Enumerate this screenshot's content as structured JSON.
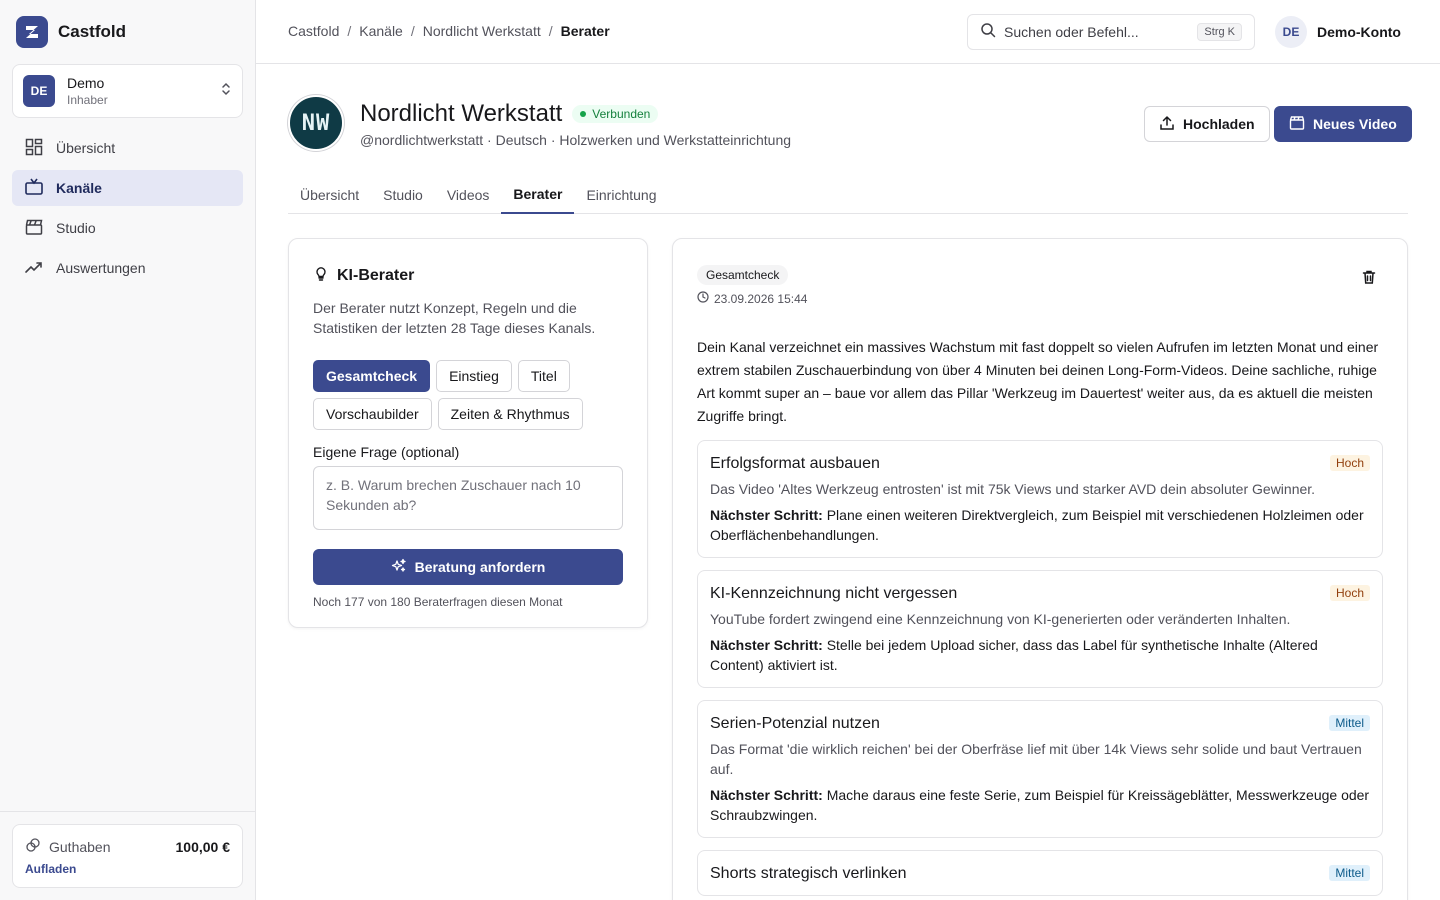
{
  "brand": {
    "name": "Castfold"
  },
  "account": {
    "initials": "DE",
    "name": "Demo",
    "role": "Inhaber"
  },
  "nav": [
    {
      "label": "Übersicht",
      "icon": "grid-icon"
    },
    {
      "label": "Kanäle",
      "icon": "tv-icon"
    },
    {
      "label": "Studio",
      "icon": "clapperboard-icon"
    },
    {
      "label": "Auswertungen",
      "icon": "trend-icon"
    }
  ],
  "balance": {
    "label": "Guthaben",
    "value": "100,00 €",
    "link": "Aufladen"
  },
  "breadcrumb": [
    "Castfold",
    "Kanäle",
    "Nordlicht Werkstatt",
    "Berater"
  ],
  "search": {
    "placeholder": "Suchen oder Befehl...",
    "shortcut": "Strg K"
  },
  "user": {
    "initials": "DE",
    "name": "Demo-Konto"
  },
  "channel": {
    "avatar_text": "NW",
    "name": "Nordlicht Werkstatt",
    "status": "Verbunden",
    "meta": "@nordlichtwerkstatt · Deutsch · Holzwerken und Werkstatteinrichtung",
    "upload_label": "Hochladen",
    "new_video_label": "Neues Video",
    "accent": "#3b4a8f"
  },
  "tabs": [
    "Übersicht",
    "Studio",
    "Videos",
    "Berater",
    "Einrichtung"
  ],
  "advisor": {
    "title": "KI-Berater",
    "description": "Der Berater nutzt Konzept, Regeln und die Statistiken der letzten 28 Tage dieses Kanals.",
    "chips": [
      "Gesamtcheck",
      "Einstieg",
      "Titel",
      "Vorschaubilder",
      "Zeiten & Rhythmus"
    ],
    "question_label": "Eigene Frage (optional)",
    "question_placeholder": "z. B. Warum brechen Zuschauer nach 10 Sekunden ab?",
    "submit_label": "Beratung anfordern",
    "quota": "Noch 177 von 180 Beraterfragen diesen Monat"
  },
  "result": {
    "tag": "Gesamtcheck",
    "date": "23.09.2026 15:44",
    "summary": "Dein Kanal verzeichnet ein massives Wachstum mit fast doppelt so vielen Aufrufen im letzten Monat und einer extrem stabilen Zuschauerbindung von über 4 Minuten bei deinen Long-Form-Videos. Deine sachliche, ruhige Art kommt super an – baue vor allem das Pillar 'Werkzeug im Dauertest' weiter aus, da es aktuell die meisten Zugriffe bringt.",
    "next_label": "Nächster Schritt:",
    "recommendations": [
      {
        "title": "Erfolgsformat ausbauen",
        "priority": "Hoch",
        "description": "Das Video 'Altes Werkzeug entrosten' ist mit 75k Views und starker AVD dein absoluter Gewinner.",
        "next": "Plane einen weiteren Direktvergleich, zum Beispiel mit verschiedenen Holzleimen oder Oberflächenbehandlungen."
      },
      {
        "title": "KI-Kennzeichnung nicht vergessen",
        "priority": "Hoch",
        "description": "YouTube fordert zwingend eine Kennzeichnung von KI-generierten oder veränderten Inhalten.",
        "next": "Stelle bei jedem Upload sicher, dass das Label für synthetische Inhalte (Altered Content) aktiviert ist."
      },
      {
        "title": "Serien-Potenzial nutzen",
        "priority": "Mittel",
        "description": "Das Format 'die wirklich reichen' bei der Oberfräse lief mit über 14k Views sehr solide und baut Vertrauen auf.",
        "next": "Mache daraus eine feste Serie, zum Beispiel für Kreissägeblätter, Messwerkzeuge oder Schraubzwingen."
      },
      {
        "title": "Shorts strategisch verlinken",
        "priority": "Mittel",
        "description": "",
        "next": ""
      }
    ]
  }
}
